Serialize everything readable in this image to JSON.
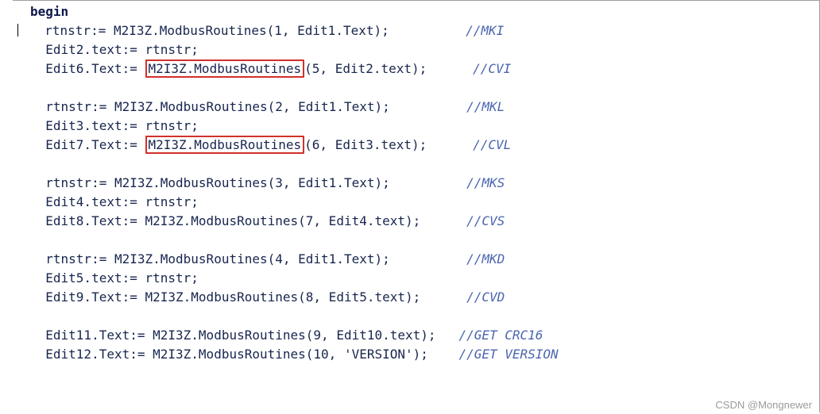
{
  "code": {
    "keyword_begin": "begin",
    "lines": [
      {
        "indent": "  ",
        "left": "rtnstr:= M2I3Z.ModbusRoutines(1, Edit1.Text);",
        "hl": "",
        "right": "",
        "gap": "          ",
        "comment": "//MKI"
      },
      {
        "indent": "  ",
        "left": "Edit2.text:= rtnstr;",
        "hl": "",
        "right": "",
        "gap": "",
        "comment": ""
      },
      {
        "indent": "  ",
        "left": "Edit6.Text:= ",
        "hl": "M2I3Z.ModbusRoutines",
        "right": "(5, Edit2.text);",
        "gap": "      ",
        "comment": "//CVI"
      },
      {
        "indent": "",
        "left": "",
        "hl": "",
        "right": "",
        "gap": "",
        "comment": ""
      },
      {
        "indent": "  ",
        "left": "rtnstr:= M2I3Z.ModbusRoutines(2, Edit1.Text);",
        "hl": "",
        "right": "",
        "gap": "          ",
        "comment": "//MKL"
      },
      {
        "indent": "  ",
        "left": "Edit3.text:= rtnstr;",
        "hl": "",
        "right": "",
        "gap": "",
        "comment": ""
      },
      {
        "indent": "  ",
        "left": "Edit7.Text:= ",
        "hl": "M2I3Z.ModbusRoutines",
        "right": "(6, Edit3.text);",
        "gap": "      ",
        "comment": "//CVL"
      },
      {
        "indent": "",
        "left": "",
        "hl": "",
        "right": "",
        "gap": "",
        "comment": ""
      },
      {
        "indent": "  ",
        "left": "rtnstr:= M2I3Z.ModbusRoutines(3, Edit1.Text);",
        "hl": "",
        "right": "",
        "gap": "          ",
        "comment": "//MKS"
      },
      {
        "indent": "  ",
        "left": "Edit4.text:= rtnstr;",
        "hl": "",
        "right": "",
        "gap": "",
        "comment": ""
      },
      {
        "indent": "  ",
        "left": "Edit8.Text:= M2I3Z.ModbusRoutines(7, Edit4.text);",
        "hl": "",
        "right": "",
        "gap": "      ",
        "comment": "//CVS"
      },
      {
        "indent": "",
        "left": "",
        "hl": "",
        "right": "",
        "gap": "",
        "comment": ""
      },
      {
        "indent": "  ",
        "left": "rtnstr:= M2I3Z.ModbusRoutines(4, Edit1.Text);",
        "hl": "",
        "right": "",
        "gap": "          ",
        "comment": "//MKD"
      },
      {
        "indent": "  ",
        "left": "Edit5.text:= rtnstr;",
        "hl": "",
        "right": "",
        "gap": "",
        "comment": ""
      },
      {
        "indent": "  ",
        "left": "Edit9.Text:= M2I3Z.ModbusRoutines(8, Edit5.text);",
        "hl": "",
        "right": "",
        "gap": "      ",
        "comment": "//CVD"
      },
      {
        "indent": "",
        "left": "",
        "hl": "",
        "right": "",
        "gap": "",
        "comment": ""
      },
      {
        "indent": "  ",
        "left": "Edit11.Text:= M2I3Z.ModbusRoutines(9, Edit10.text);",
        "hl": "",
        "right": "",
        "gap": "   ",
        "comment": "//GET CRC16"
      },
      {
        "indent": "  ",
        "left": "Edit12.Text:= M2I3Z.ModbusRoutines(10, 'VERSION');",
        "hl": "",
        "right": "",
        "gap": "    ",
        "comment": "//GET VERSION"
      }
    ]
  },
  "watermark": "CSDN @Mongnewer"
}
